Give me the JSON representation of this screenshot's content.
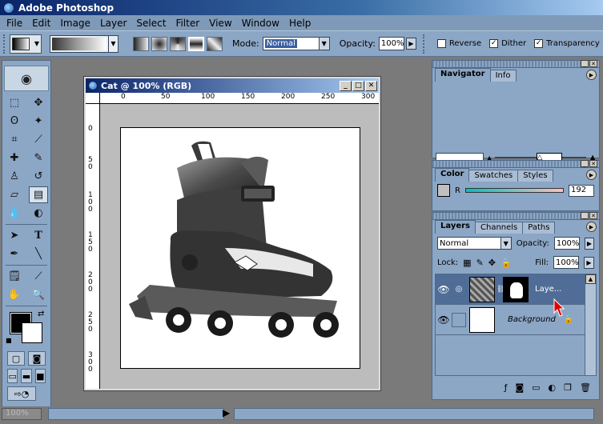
{
  "app": {
    "title": "Adobe Photoshop"
  },
  "menu": [
    "File",
    "Edit",
    "Image",
    "Layer",
    "Select",
    "Filter",
    "View",
    "Window",
    "Help"
  ],
  "options": {
    "mode_label": "Mode:",
    "mode_value": "Normal",
    "opacity_label": "Opacity:",
    "opacity_value": "100%",
    "reverse_label": "Reverse",
    "dither_label": "Dither",
    "transparency_label": "Transparency",
    "reverse_checked": false,
    "dither_checked": true,
    "transparency_checked": true
  },
  "document": {
    "title": "Cat @ 100% (RGB)",
    "ruler_h": [
      "0",
      "50",
      "100",
      "150",
      "200",
      "250",
      "300"
    ],
    "ruler_v": [
      "0",
      "5 0",
      "1 0 0",
      "1 5 0",
      "2 0 0",
      "2 5 0",
      "3 0 0"
    ]
  },
  "navigator": {
    "tabs": [
      "Navigator",
      "Info"
    ]
  },
  "color": {
    "tabs": [
      "Color",
      "Swatches",
      "Styles"
    ],
    "r_label": "R",
    "r_value": "192"
  },
  "layers": {
    "tabs": [
      "Layers",
      "Channels",
      "Paths"
    ],
    "blend_mode": "Normal",
    "opacity_label": "Opacity:",
    "opacity_value": "100%",
    "lock_label": "Lock:",
    "fill_label": "Fill:",
    "fill_value": "100%",
    "items": [
      {
        "name": "Laye...",
        "selected": true
      },
      {
        "name": "Background",
        "selected": false
      }
    ]
  },
  "status": {
    "zoom": "100%"
  },
  "colors": {
    "accent": "#0a246a",
    "panel": "#8ca6c5",
    "selected_layer": "#4f6d97",
    "pointer": "#e00000"
  }
}
